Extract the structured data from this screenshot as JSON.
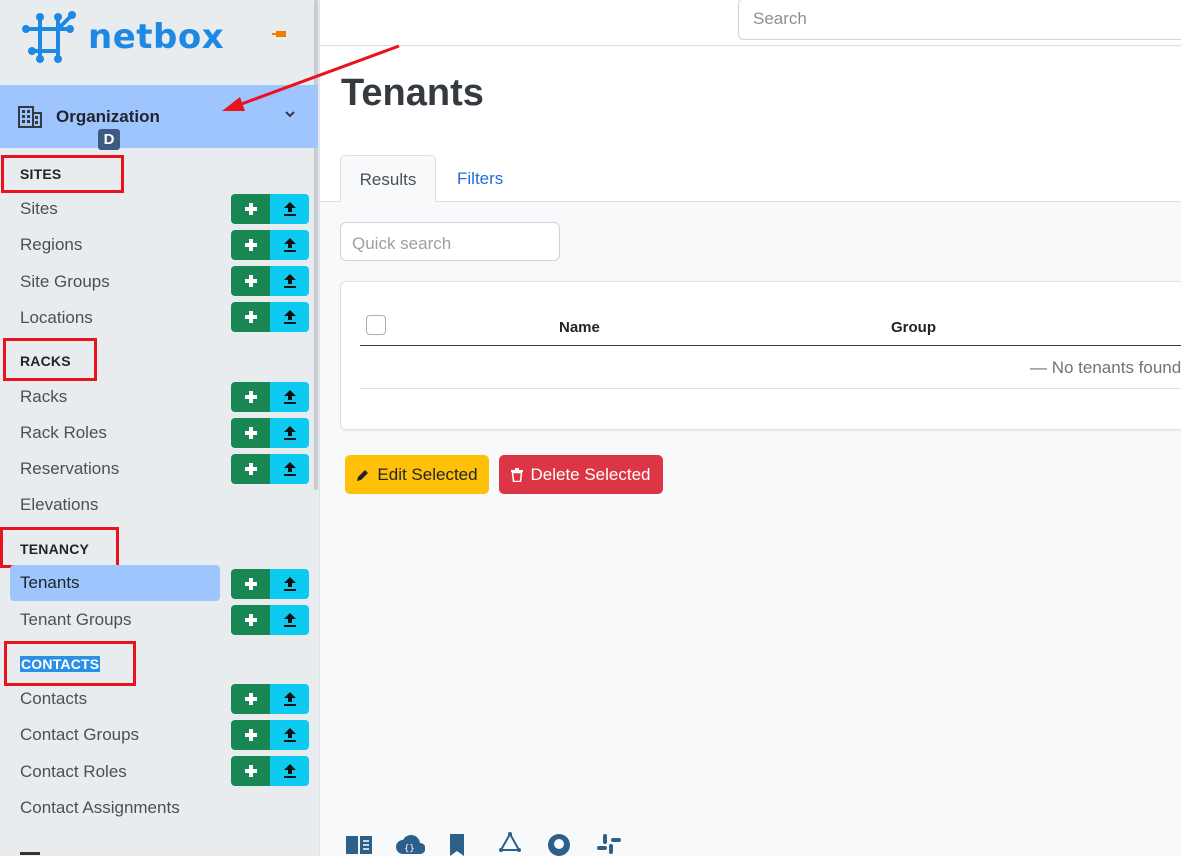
{
  "brand": {
    "name": "netbox"
  },
  "sidebar": {
    "menu_title": "Organization",
    "badge": "D",
    "sections": {
      "sites": "SITES",
      "racks": "RACKS",
      "tenancy": "TENANCY",
      "contacts": "CONTACTS"
    },
    "items": {
      "sites": "Sites",
      "regions": "Regions",
      "site_groups": "Site Groups",
      "locations": "Locations",
      "racks": "Racks",
      "rack_roles": "Rack Roles",
      "reservations": "Reservations",
      "elevations": "Elevations",
      "tenants": "Tenants",
      "tenant_groups": "Tenant Groups",
      "contacts": "Contacts",
      "contact_groups": "Contact Groups",
      "contact_roles": "Contact Roles",
      "contact_assignments": "Contact Assignments"
    },
    "active_item": "Tenants"
  },
  "topbar": {
    "search_placeholder": "Search"
  },
  "page": {
    "title": "Tenants",
    "tabs": {
      "results": "Results",
      "filters": "Filters"
    },
    "quick_search_placeholder": "Quick search",
    "table": {
      "headers": {
        "name": "Name",
        "group": "Group"
      },
      "empty_message": "— No tenants found"
    },
    "actions": {
      "edit": "Edit Selected",
      "delete": "Delete Selected"
    }
  },
  "colors": {
    "brand": "#1e88e5",
    "add_button": "#198754",
    "import_button": "#0dcaf0",
    "active_nav": "#9ec5fe",
    "edit_button": "#ffc107",
    "delete_button": "#dc3545",
    "annotation": "#e8131c"
  },
  "icons": {
    "brand_logo": "netbox-logo-icon",
    "pin": "pin-icon",
    "menu": "building-icon",
    "expand": "chevron-down-icon",
    "add": "plus-icon",
    "import": "upload-icon",
    "edit": "pencil-icon",
    "delete": "trash-icon",
    "footer": [
      "book-icon",
      "api-cloud-icon",
      "bookmark-icon",
      "graphql-icon",
      "github-icon",
      "slack-icon"
    ]
  }
}
